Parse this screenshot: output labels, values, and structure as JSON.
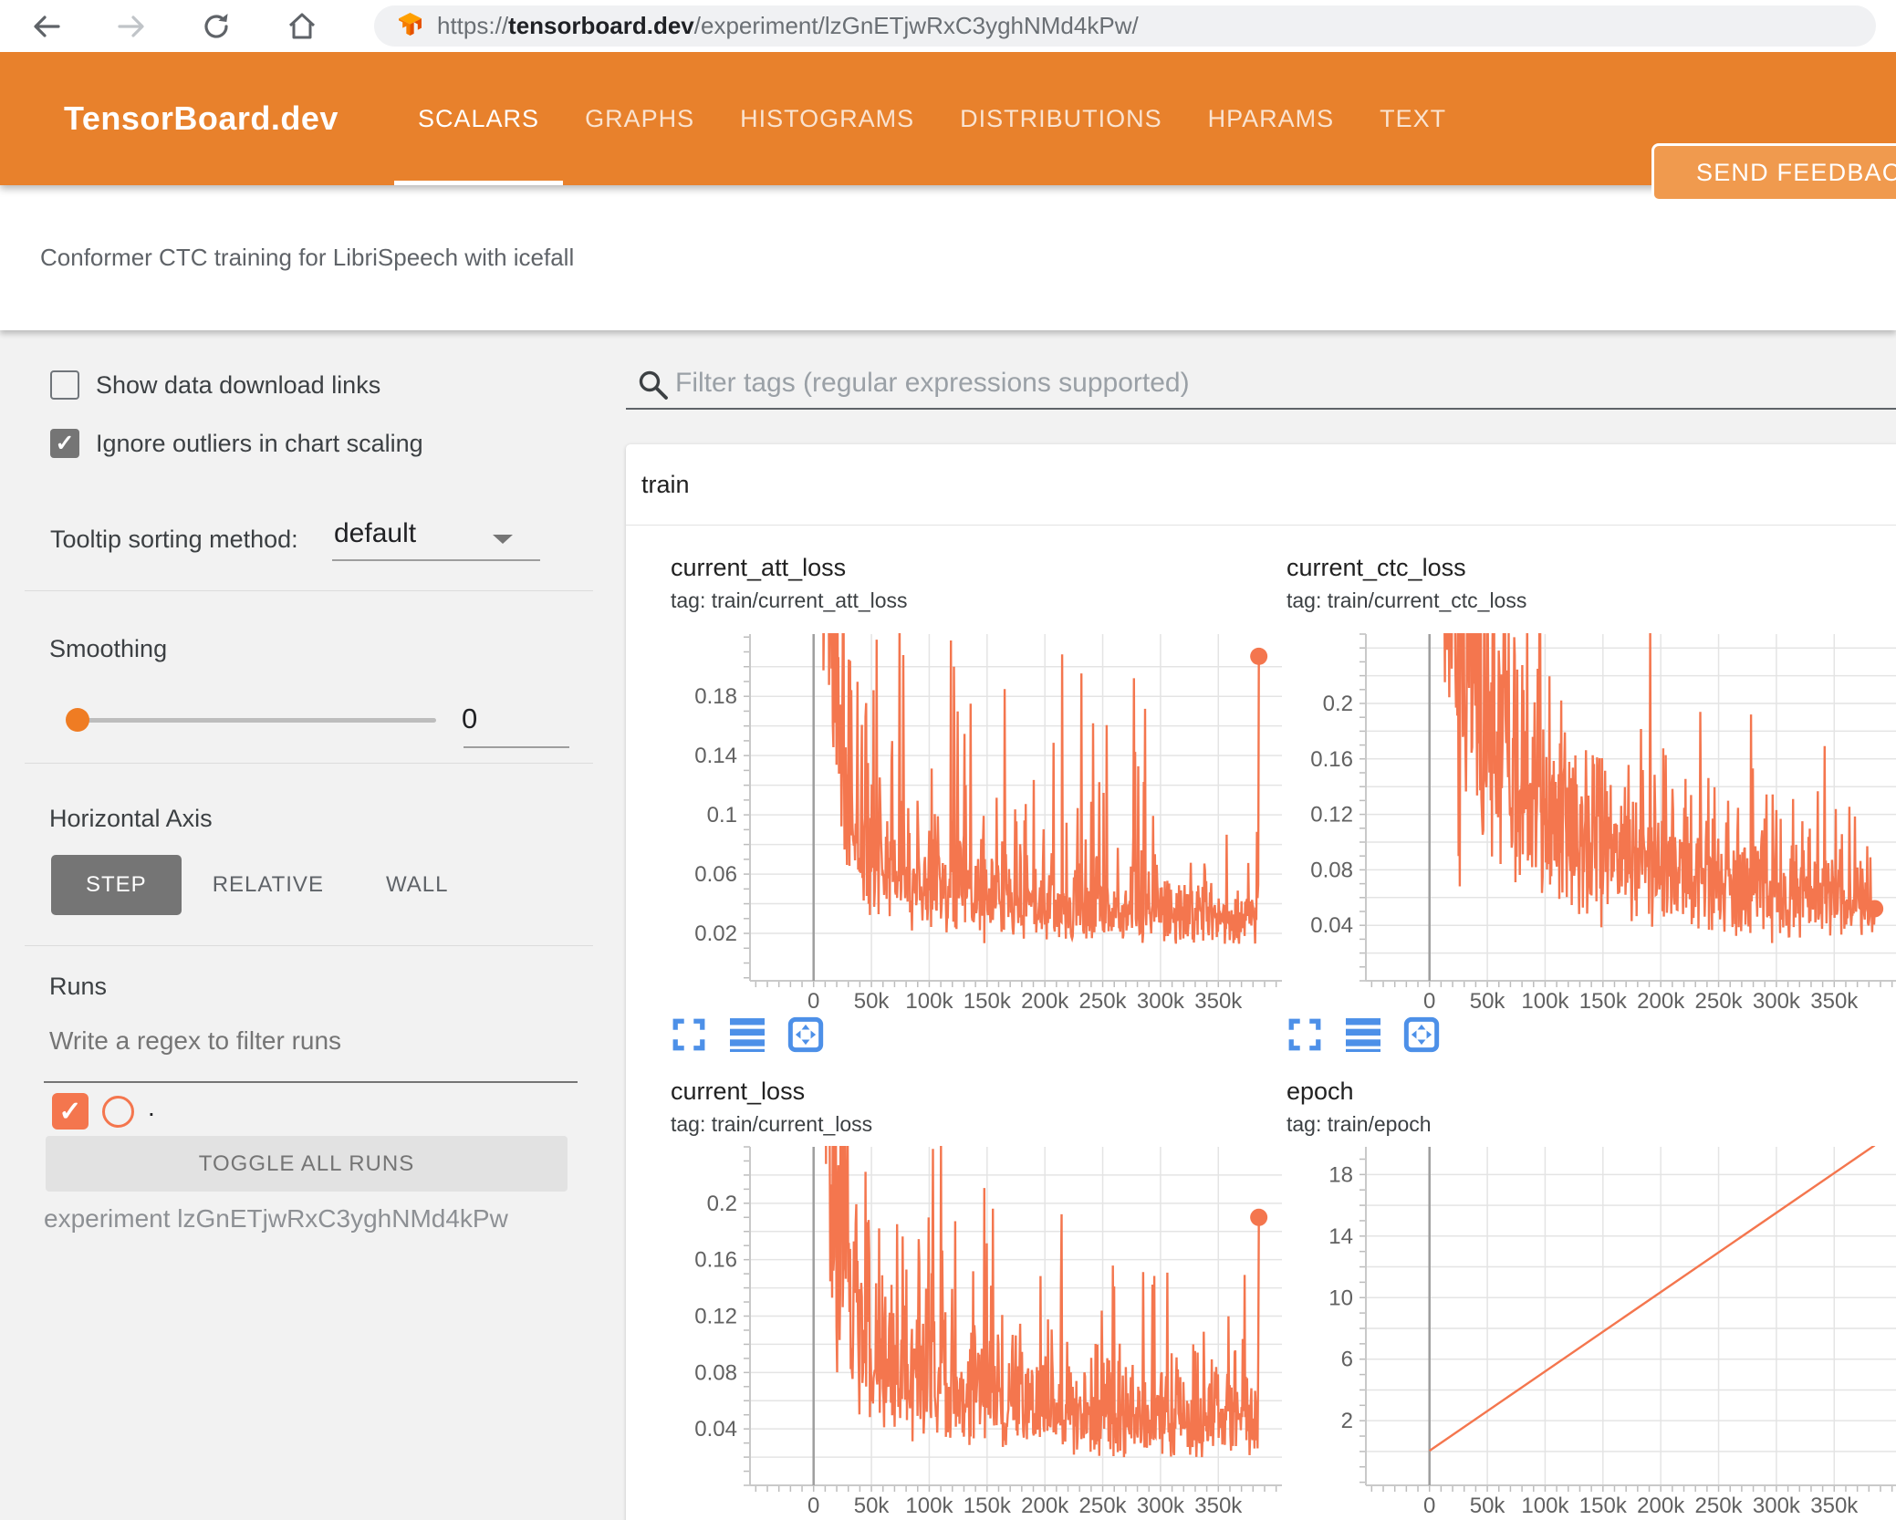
{
  "browser": {
    "url": {
      "scheme": "https://",
      "domain": "tensorboard.dev",
      "path": "/experiment/lzGnETjwRxC3yghNMd4kPw/"
    }
  },
  "header": {
    "brand": "TensorBoard.dev",
    "tabs": [
      {
        "label": "SCALARS",
        "active": true
      },
      {
        "label": "GRAPHS",
        "active": false
      },
      {
        "label": "HISTOGRAMS",
        "active": false
      },
      {
        "label": "DISTRIBUTIONS",
        "active": false
      },
      {
        "label": "HPARAMS",
        "active": false
      },
      {
        "label": "TEXT",
        "active": false
      }
    ],
    "feedback_button": "SEND FEEDBACK"
  },
  "title_bar": {
    "experiment_title": "Conformer CTC training for LibriSpeech with icefall"
  },
  "sidebar": {
    "show_download_links": {
      "label": "Show data download links",
      "checked": false
    },
    "ignore_outliers": {
      "label": "Ignore outliers in chart scaling",
      "checked": true
    },
    "tooltip_sorting": {
      "label": "Tooltip sorting method:",
      "value": "default"
    },
    "smoothing": {
      "label": "Smoothing",
      "value": "0"
    },
    "horizontal_axis": {
      "label": "Horizontal Axis",
      "options": [
        "STEP",
        "RELATIVE",
        "WALL"
      ],
      "selected": "STEP"
    },
    "runs": {
      "heading": "Runs",
      "filter_placeholder": "Write a regex to filter runs",
      "run_label": ".",
      "run_checked": true,
      "toggle_all_label": "TOGGLE ALL RUNS",
      "experiment_caption": "experiment lzGnETjwRxC3yghNMd4kPw"
    }
  },
  "main": {
    "filter_placeholder": "Filter tags (regular expressions supported)",
    "card_title": "train",
    "toolbar_icons": [
      "expand-chart",
      "log-scale",
      "fit-domain"
    ]
  },
  "colors": {
    "header_orange": "#e8812c",
    "run_series_orange": "#f4764e",
    "toolbar_icon_blue": "#4d90e8",
    "slider_thumb_orange": "#ef7c23"
  },
  "chart_data": [
    {
      "type": "line",
      "title": "current_att_loss",
      "tag": "tag: train/current_att_loss",
      "series_color": "#f4764e",
      "x_tick_values": [
        0,
        50000,
        100000,
        150000,
        200000,
        250000,
        300000,
        350000
      ],
      "x_tick_labels": [
        "0",
        "50k",
        "100k",
        "150k",
        "200k",
        "250k",
        "300k",
        "350k"
      ],
      "x_domain": [
        -55000,
        405000
      ],
      "x_data_max": 385000,
      "x_minor_step": 10000,
      "ylim": [
        -0.012,
        0.222
      ],
      "y_grid_min": 0.02,
      "y_grid_max": 0.2,
      "y_grid_step": 0.02,
      "y_minor_step": 0.01,
      "y_ticks": [
        {
          "v": 0.02,
          "label": "0.02"
        },
        {
          "v": 0.06,
          "label": "0.06"
        },
        {
          "v": 0.1,
          "label": "0.1"
        },
        {
          "v": 0.14,
          "label": "0.14"
        },
        {
          "v": 0.18,
          "label": "0.18"
        }
      ],
      "profile": {
        "style": "noisy-decay",
        "seed": 7,
        "points": 720,
        "noise": 0.42,
        "spike_prob": 0.05,
        "spike_amp": 0.17,
        "floor": 0.013,
        "baseline": [
          [
            0,
            0.5
          ],
          [
            8000,
            0.32
          ],
          [
            20000,
            0.16
          ],
          [
            40000,
            0.085
          ],
          [
            70000,
            0.062
          ],
          [
            120000,
            0.05
          ],
          [
            180000,
            0.042
          ],
          [
            250000,
            0.036
          ],
          [
            320000,
            0.032
          ],
          [
            385000,
            0.03
          ]
        ]
      },
      "end_value": 0.207,
      "end_marker": true
    },
    {
      "type": "line",
      "title": "current_ctc_loss",
      "tag": "tag: train/current_ctc_loss",
      "series_color": "#f4764e",
      "x_tick_values": [
        0,
        50000,
        100000,
        150000,
        200000,
        250000,
        300000,
        350000
      ],
      "x_tick_labels": [
        "0",
        "50k",
        "100k",
        "150k",
        "200k",
        "250k",
        "300k",
        "350k"
      ],
      "x_domain": [
        -55000,
        405000
      ],
      "x_data_max": 385000,
      "x_minor_step": 10000,
      "ylim": [
        0,
        0.25
      ],
      "y_grid_min": 0.02,
      "y_grid_max": 0.24,
      "y_grid_step": 0.02,
      "y_minor_step": 0.01,
      "y_ticks": [
        {
          "v": 0.04,
          "label": "0.04"
        },
        {
          "v": 0.08,
          "label": "0.08"
        },
        {
          "v": 0.12,
          "label": "0.12"
        },
        {
          "v": 0.16,
          "label": "0.16"
        },
        {
          "v": 0.2,
          "label": "0.2"
        }
      ],
      "profile": {
        "style": "noisy-decay",
        "seed": 11,
        "points": 720,
        "noise": 0.33,
        "spike_prob": 0.045,
        "spike_amp": 0.09,
        "floor": 0.027,
        "baseline": [
          [
            0,
            0.6
          ],
          [
            10000,
            0.38
          ],
          [
            25000,
            0.24
          ],
          [
            50000,
            0.17
          ],
          [
            80000,
            0.13
          ],
          [
            120000,
            0.1
          ],
          [
            170000,
            0.085
          ],
          [
            230000,
            0.073
          ],
          [
            300000,
            0.064
          ],
          [
            385000,
            0.057
          ]
        ]
      },
      "end_value": 0.052,
      "end_marker": true
    },
    {
      "type": "line",
      "title": "current_loss",
      "tag": "tag: train/current_loss",
      "series_color": "#f4764e",
      "x_tick_values": [
        0,
        50000,
        100000,
        150000,
        200000,
        250000,
        300000,
        350000
      ],
      "x_tick_labels": [
        "0",
        "50k",
        "100k",
        "150k",
        "200k",
        "250k",
        "300k",
        "350k"
      ],
      "x_domain": [
        -55000,
        405000
      ],
      "x_data_max": 385000,
      "x_minor_step": 10000,
      "ylim": [
        0,
        0.24
      ],
      "y_grid_min": 0.02,
      "y_grid_max": 0.22,
      "y_grid_step": 0.02,
      "y_minor_step": 0.01,
      "y_ticks": [
        {
          "v": 0.04,
          "label": "0.04"
        },
        {
          "v": 0.08,
          "label": "0.08"
        },
        {
          "v": 0.12,
          "label": "0.12"
        },
        {
          "v": 0.16,
          "label": "0.16"
        },
        {
          "v": 0.2,
          "label": "0.2"
        }
      ],
      "profile": {
        "style": "noisy-decay",
        "seed": 5,
        "points": 720,
        "noise": 0.4,
        "spike_prob": 0.05,
        "spike_amp": 0.13,
        "floor": 0.02,
        "baseline": [
          [
            0,
            0.55
          ],
          [
            8000,
            0.36
          ],
          [
            20000,
            0.19
          ],
          [
            40000,
            0.115
          ],
          [
            70000,
            0.09
          ],
          [
            120000,
            0.072
          ],
          [
            180000,
            0.06
          ],
          [
            250000,
            0.052
          ],
          [
            320000,
            0.047
          ],
          [
            385000,
            0.044
          ]
        ]
      },
      "end_value": 0.19,
      "end_marker": true
    },
    {
      "type": "line",
      "title": "epoch",
      "tag": "tag: train/epoch",
      "series_color": "#f4764e",
      "x_tick_values": [
        0,
        50000,
        100000,
        150000,
        200000,
        250000,
        300000,
        350000
      ],
      "x_tick_labels": [
        "0",
        "50k",
        "100k",
        "150k",
        "200k",
        "250k",
        "300k",
        "350k"
      ],
      "x_domain": [
        -55000,
        405000
      ],
      "x_data_max": 385000,
      "x_minor_step": 10000,
      "ylim": [
        -2.2,
        19.8
      ],
      "y_grid_min": 0,
      "y_grid_max": 18,
      "y_grid_step": 2,
      "y_minor_step": 1,
      "y_ticks": [
        {
          "v": 2,
          "label": "2"
        },
        {
          "v": 6,
          "label": "6"
        },
        {
          "v": 10,
          "label": "10"
        },
        {
          "v": 14,
          "label": "14"
        },
        {
          "v": 18,
          "label": "18"
        }
      ],
      "profile": {
        "style": "linear",
        "points_xy": [
          [
            0,
            0.05
          ],
          [
            385000,
            19.9
          ]
        ]
      },
      "end_value": 19.9,
      "end_marker": false
    }
  ]
}
